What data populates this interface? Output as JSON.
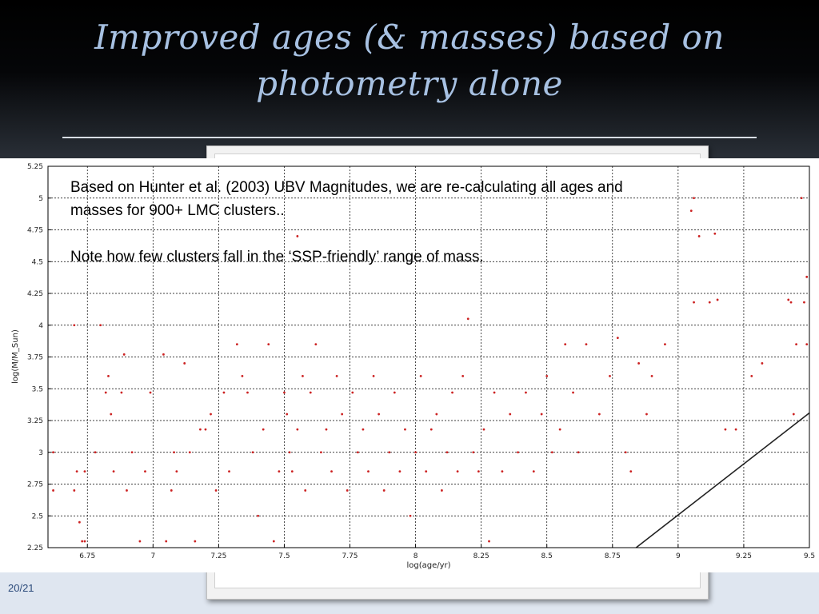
{
  "slide": {
    "title": "Improved ages (& masses) based on photometry alone",
    "page_number": "20/21",
    "note_1": "Based on Hunter et al. (2003) UBV Magnitudes, we are re-calculating all ages and masses for 900+ LMC clusters..",
    "note_2": "Note how few clusters fall in the ‘SSP-friendly’ range of mass."
  },
  "colors": {
    "title": "#a7c1e2",
    "points": "#cc2222",
    "grid": "#000000",
    "line": "#222222"
  },
  "chart_data": {
    "type": "scatter",
    "xlabel": "log(age/yr)",
    "ylabel": "log(M/M_Sun)",
    "xlim": [
      6.6,
      9.5
    ],
    "ylim": [
      2.25,
      5.25
    ],
    "xticks": [
      6.75,
      7,
      7.25,
      7.5,
      7.75,
      8,
      8.25,
      8.5,
      8.75,
      9,
      9.25,
      9.5
    ],
    "xtick_labels": [
      "6.75",
      "7",
      "7.25",
      "7.5",
      "7.75",
      "8",
      "8.25",
      "8.5",
      "8.75",
      "9",
      "9.25",
      "9.5"
    ],
    "yticks": [
      2.25,
      2.5,
      2.75,
      3,
      3.25,
      3.5,
      3.75,
      4,
      4.25,
      4.5,
      4.75,
      5,
      5.25
    ],
    "ytick_labels": [
      "2.25",
      "2.5",
      "2.75",
      "3",
      "3.25",
      "3.5",
      "3.75",
      "4",
      "4.25",
      "4.5",
      "4.75",
      "5",
      "5.25"
    ],
    "grid": true,
    "line": {
      "x": [
        8.84,
        9.5
      ],
      "y": [
        2.25,
        3.31
      ]
    },
    "points": [
      [
        6.62,
        2.7
      ],
      [
        6.62,
        3.0
      ],
      [
        6.7,
        4.0
      ],
      [
        6.7,
        2.7
      ],
      [
        6.71,
        2.85
      ],
      [
        6.72,
        2.45
      ],
      [
        6.73,
        2.3
      ],
      [
        6.74,
        2.3
      ],
      [
        6.74,
        2.85
      ],
      [
        6.78,
        3.0
      ],
      [
        6.8,
        4.0
      ],
      [
        6.82,
        3.47
      ],
      [
        6.83,
        3.6
      ],
      [
        6.84,
        3.3
      ],
      [
        6.85,
        2.85
      ],
      [
        6.88,
        3.47
      ],
      [
        6.89,
        3.77
      ],
      [
        6.9,
        2.7
      ],
      [
        6.92,
        3.0
      ],
      [
        6.95,
        2.3
      ],
      [
        6.97,
        2.85
      ],
      [
        6.99,
        3.47
      ],
      [
        7.04,
        3.77
      ],
      [
        7.05,
        2.3
      ],
      [
        7.07,
        2.7
      ],
      [
        7.08,
        3.0
      ],
      [
        7.09,
        2.85
      ],
      [
        7.12,
        3.7
      ],
      [
        7.14,
        3.0
      ],
      [
        7.16,
        2.3
      ],
      [
        7.18,
        3.18
      ],
      [
        7.2,
        3.18
      ],
      [
        7.22,
        3.3
      ],
      [
        7.24,
        2.7
      ],
      [
        7.27,
        3.47
      ],
      [
        7.29,
        2.85
      ],
      [
        7.32,
        3.85
      ],
      [
        7.34,
        3.6
      ],
      [
        7.36,
        3.47
      ],
      [
        7.38,
        3.0
      ],
      [
        7.4,
        2.5
      ],
      [
        7.42,
        3.18
      ],
      [
        7.44,
        3.85
      ],
      [
        7.46,
        2.3
      ],
      [
        7.48,
        2.85
      ],
      [
        7.5,
        3.47
      ],
      [
        7.51,
        3.3
      ],
      [
        7.52,
        3.0
      ],
      [
        7.53,
        2.85
      ],
      [
        7.55,
        3.18
      ],
      [
        7.55,
        4.7
      ],
      [
        7.57,
        3.6
      ],
      [
        7.58,
        2.7
      ],
      [
        7.6,
        3.47
      ],
      [
        7.62,
        3.85
      ],
      [
        7.64,
        3.0
      ],
      [
        7.66,
        3.18
      ],
      [
        7.68,
        2.85
      ],
      [
        7.7,
        3.6
      ],
      [
        7.72,
        3.3
      ],
      [
        7.74,
        2.7
      ],
      [
        7.76,
        3.47
      ],
      [
        7.78,
        3.0
      ],
      [
        7.8,
        3.18
      ],
      [
        7.82,
        2.85
      ],
      [
        7.84,
        3.6
      ],
      [
        7.86,
        3.3
      ],
      [
        7.88,
        2.7
      ],
      [
        7.9,
        3.0
      ],
      [
        7.92,
        3.47
      ],
      [
        7.94,
        2.85
      ],
      [
        7.96,
        3.18
      ],
      [
        7.98,
        2.5
      ],
      [
        8.0,
        3.0
      ],
      [
        8.02,
        3.6
      ],
      [
        8.04,
        2.85
      ],
      [
        8.06,
        3.18
      ],
      [
        8.08,
        3.3
      ],
      [
        8.1,
        2.7
      ],
      [
        8.12,
        3.0
      ],
      [
        8.14,
        3.47
      ],
      [
        8.16,
        2.85
      ],
      [
        8.18,
        3.6
      ],
      [
        8.2,
        4.05
      ],
      [
        8.22,
        3.0
      ],
      [
        8.24,
        2.85
      ],
      [
        8.26,
        3.18
      ],
      [
        8.28,
        2.3
      ],
      [
        8.3,
        3.47
      ],
      [
        8.33,
        2.85
      ],
      [
        8.36,
        3.3
      ],
      [
        8.39,
        3.0
      ],
      [
        8.42,
        3.47
      ],
      [
        8.45,
        2.85
      ],
      [
        8.48,
        3.3
      ],
      [
        8.5,
        3.6
      ],
      [
        8.52,
        3.0
      ],
      [
        8.55,
        3.18
      ],
      [
        8.57,
        3.85
      ],
      [
        8.6,
        3.47
      ],
      [
        8.62,
        3.0
      ],
      [
        8.65,
        3.85
      ],
      [
        8.7,
        3.3
      ],
      [
        8.74,
        3.6
      ],
      [
        8.77,
        3.9
      ],
      [
        8.8,
        3.0
      ],
      [
        8.82,
        2.85
      ],
      [
        8.85,
        3.7
      ],
      [
        8.88,
        3.3
      ],
      [
        8.9,
        3.6
      ],
      [
        8.95,
        3.85
      ],
      [
        9.05,
        4.9
      ],
      [
        9.06,
        5.0
      ],
      [
        9.06,
        4.18
      ],
      [
        9.08,
        4.7
      ],
      [
        9.12,
        4.18
      ],
      [
        9.14,
        4.72
      ],
      [
        9.15,
        4.2
      ],
      [
        9.18,
        3.18
      ],
      [
        9.22,
        3.18
      ],
      [
        9.28,
        3.6
      ],
      [
        9.32,
        3.7
      ],
      [
        9.42,
        4.2
      ],
      [
        9.43,
        4.18
      ],
      [
        9.44,
        3.3
      ],
      [
        9.45,
        3.85
      ],
      [
        9.47,
        5.0
      ],
      [
        9.48,
        4.18
      ],
      [
        9.49,
        4.38
      ],
      [
        9.49,
        3.85
      ]
    ]
  }
}
